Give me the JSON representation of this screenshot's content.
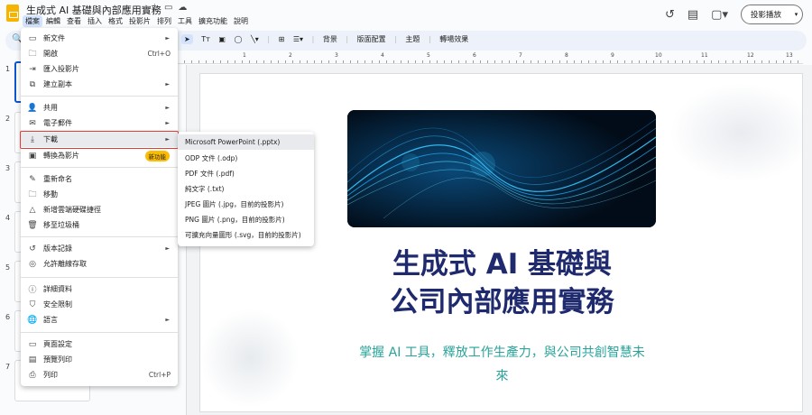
{
  "window": {
    "doc_title": "生成式 AI 基礎與內部應用實務",
    "menu": [
      "檔案",
      "編輯",
      "查看",
      "插入",
      "格式",
      "投影片",
      "排列",
      "工具",
      "擴充功能",
      "說明"
    ],
    "present_label": "投影播放"
  },
  "toolbar": {
    "items": [
      "背景",
      "版面配置",
      "主題",
      "轉場效果"
    ]
  },
  "ruler": {
    "ticks": [
      "1",
      "2",
      "3",
      "4",
      "5",
      "6",
      "7",
      "8",
      "9",
      "10",
      "11",
      "12",
      "13"
    ]
  },
  "filmstrip": {
    "slide_numbers": [
      "1",
      "2",
      "3",
      "4",
      "5",
      "6",
      "7"
    ]
  },
  "file_menu": {
    "items": [
      {
        "label": "新文件",
        "icon": "new-doc-icon",
        "arrow": true
      },
      {
        "label": "開啟",
        "icon": "folder-icon",
        "shortcut": "Ctrl+O"
      },
      {
        "label": "匯入投影片",
        "icon": "import-icon"
      },
      {
        "label": "建立副本",
        "icon": "copy-icon",
        "arrow": true
      },
      {
        "label": "共用",
        "icon": "share-icon",
        "arrow": true
      },
      {
        "label": "電子郵件",
        "icon": "email-icon",
        "arrow": true
      },
      {
        "label": "下載",
        "icon": "download-icon",
        "arrow": true
      },
      {
        "label": "轉換為影片",
        "icon": "video-icon",
        "badge": "新功能"
      },
      {
        "label": "重新命名",
        "icon": "rename-icon"
      },
      {
        "label": "移動",
        "icon": "move-icon"
      },
      {
        "label": "新增雲端硬碟捷徑",
        "icon": "drive-shortcut-icon"
      },
      {
        "label": "移至垃圾桶",
        "icon": "trash-icon"
      },
      {
        "label": "版本記錄",
        "icon": "history-icon",
        "arrow": true
      },
      {
        "label": "允許離線存取",
        "icon": "offline-icon"
      },
      {
        "label": "詳細資料",
        "icon": "info-icon"
      },
      {
        "label": "安全限制",
        "icon": "security-icon"
      },
      {
        "label": "語言",
        "icon": "globe-icon",
        "arrow": true
      },
      {
        "label": "頁面設定",
        "icon": "page-setup-icon"
      },
      {
        "label": "預覽列印",
        "icon": "print-preview-icon"
      },
      {
        "label": "列印",
        "icon": "print-icon",
        "shortcut": "Ctrl+P"
      }
    ]
  },
  "download_submenu": {
    "items": [
      "Microsoft PowerPoint (.pptx)",
      "ODP 文件 (.odp)",
      "PDF 文件 (.pdf)",
      "純文字 (.txt)",
      "JPEG 圖片 (.jpg，目前的投影片)",
      "PNG 圖片 (.png，目前的投影片)",
      "可擴充向量圖形 (.svg，目前的投影片)"
    ]
  },
  "slide": {
    "title_line1": "生成式 AI 基礎與",
    "title_line2": "公司內部應用實務",
    "subtitle_line1": "掌握 AI 工具，釋放工作生產力，與公司共創智慧未",
    "subtitle_line2": "來"
  },
  "colors": {
    "accent": "#0b57d0",
    "title": "#1f2a6e",
    "subtitle": "#2aa39a",
    "highlight_border": "#e53935",
    "badge": "#fbbc04"
  }
}
